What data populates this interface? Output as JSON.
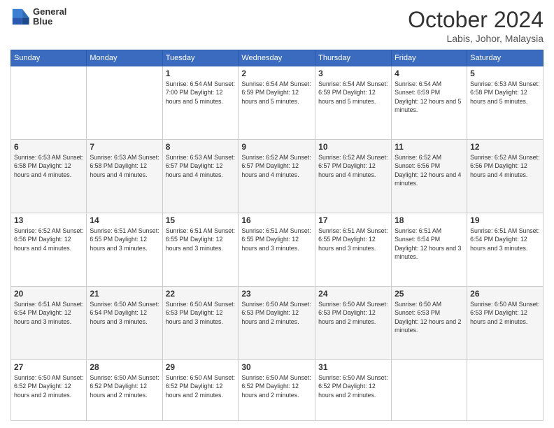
{
  "header": {
    "logo_line1": "General",
    "logo_line2": "Blue",
    "month": "October 2024",
    "location": "Labis, Johor, Malaysia"
  },
  "weekdays": [
    "Sunday",
    "Monday",
    "Tuesday",
    "Wednesday",
    "Thursday",
    "Friday",
    "Saturday"
  ],
  "weeks": [
    [
      {
        "day": "",
        "info": ""
      },
      {
        "day": "",
        "info": ""
      },
      {
        "day": "1",
        "info": "Sunrise: 6:54 AM\nSunset: 7:00 PM\nDaylight: 12 hours\nand 5 minutes."
      },
      {
        "day": "2",
        "info": "Sunrise: 6:54 AM\nSunset: 6:59 PM\nDaylight: 12 hours\nand 5 minutes."
      },
      {
        "day": "3",
        "info": "Sunrise: 6:54 AM\nSunset: 6:59 PM\nDaylight: 12 hours\nand 5 minutes."
      },
      {
        "day": "4",
        "info": "Sunrise: 6:54 AM\nSunset: 6:59 PM\nDaylight: 12 hours\nand 5 minutes."
      },
      {
        "day": "5",
        "info": "Sunrise: 6:53 AM\nSunset: 6:58 PM\nDaylight: 12 hours\nand 5 minutes."
      }
    ],
    [
      {
        "day": "6",
        "info": "Sunrise: 6:53 AM\nSunset: 6:58 PM\nDaylight: 12 hours\nand 4 minutes."
      },
      {
        "day": "7",
        "info": "Sunrise: 6:53 AM\nSunset: 6:58 PM\nDaylight: 12 hours\nand 4 minutes."
      },
      {
        "day": "8",
        "info": "Sunrise: 6:53 AM\nSunset: 6:57 PM\nDaylight: 12 hours\nand 4 minutes."
      },
      {
        "day": "9",
        "info": "Sunrise: 6:52 AM\nSunset: 6:57 PM\nDaylight: 12 hours\nand 4 minutes."
      },
      {
        "day": "10",
        "info": "Sunrise: 6:52 AM\nSunset: 6:57 PM\nDaylight: 12 hours\nand 4 minutes."
      },
      {
        "day": "11",
        "info": "Sunrise: 6:52 AM\nSunset: 6:56 PM\nDaylight: 12 hours\nand 4 minutes."
      },
      {
        "day": "12",
        "info": "Sunrise: 6:52 AM\nSunset: 6:56 PM\nDaylight: 12 hours\nand 4 minutes."
      }
    ],
    [
      {
        "day": "13",
        "info": "Sunrise: 6:52 AM\nSunset: 6:56 PM\nDaylight: 12 hours\nand 4 minutes."
      },
      {
        "day": "14",
        "info": "Sunrise: 6:51 AM\nSunset: 6:55 PM\nDaylight: 12 hours\nand 3 minutes."
      },
      {
        "day": "15",
        "info": "Sunrise: 6:51 AM\nSunset: 6:55 PM\nDaylight: 12 hours\nand 3 minutes."
      },
      {
        "day": "16",
        "info": "Sunrise: 6:51 AM\nSunset: 6:55 PM\nDaylight: 12 hours\nand 3 minutes."
      },
      {
        "day": "17",
        "info": "Sunrise: 6:51 AM\nSunset: 6:55 PM\nDaylight: 12 hours\nand 3 minutes."
      },
      {
        "day": "18",
        "info": "Sunrise: 6:51 AM\nSunset: 6:54 PM\nDaylight: 12 hours\nand 3 minutes."
      },
      {
        "day": "19",
        "info": "Sunrise: 6:51 AM\nSunset: 6:54 PM\nDaylight: 12 hours\nand 3 minutes."
      }
    ],
    [
      {
        "day": "20",
        "info": "Sunrise: 6:51 AM\nSunset: 6:54 PM\nDaylight: 12 hours\nand 3 minutes."
      },
      {
        "day": "21",
        "info": "Sunrise: 6:50 AM\nSunset: 6:54 PM\nDaylight: 12 hours\nand 3 minutes."
      },
      {
        "day": "22",
        "info": "Sunrise: 6:50 AM\nSunset: 6:53 PM\nDaylight: 12 hours\nand 3 minutes."
      },
      {
        "day": "23",
        "info": "Sunrise: 6:50 AM\nSunset: 6:53 PM\nDaylight: 12 hours\nand 2 minutes."
      },
      {
        "day": "24",
        "info": "Sunrise: 6:50 AM\nSunset: 6:53 PM\nDaylight: 12 hours\nand 2 minutes."
      },
      {
        "day": "25",
        "info": "Sunrise: 6:50 AM\nSunset: 6:53 PM\nDaylight: 12 hours\nand 2 minutes."
      },
      {
        "day": "26",
        "info": "Sunrise: 6:50 AM\nSunset: 6:53 PM\nDaylight: 12 hours\nand 2 minutes."
      }
    ],
    [
      {
        "day": "27",
        "info": "Sunrise: 6:50 AM\nSunset: 6:52 PM\nDaylight: 12 hours\nand 2 minutes."
      },
      {
        "day": "28",
        "info": "Sunrise: 6:50 AM\nSunset: 6:52 PM\nDaylight: 12 hours\nand 2 minutes."
      },
      {
        "day": "29",
        "info": "Sunrise: 6:50 AM\nSunset: 6:52 PM\nDaylight: 12 hours\nand 2 minutes."
      },
      {
        "day": "30",
        "info": "Sunrise: 6:50 AM\nSunset: 6:52 PM\nDaylight: 12 hours\nand 2 minutes."
      },
      {
        "day": "31",
        "info": "Sunrise: 6:50 AM\nSunset: 6:52 PM\nDaylight: 12 hours\nand 2 minutes."
      },
      {
        "day": "",
        "info": ""
      },
      {
        "day": "",
        "info": ""
      }
    ]
  ]
}
